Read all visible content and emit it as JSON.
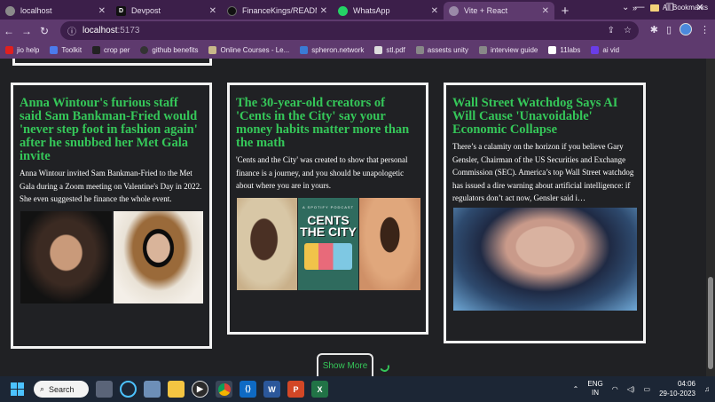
{
  "browser": {
    "tabs": [
      {
        "title": "localhost",
        "active": false,
        "favicon": "globe-icon"
      },
      {
        "title": "Devpost",
        "active": false,
        "favicon": "devpost-icon"
      },
      {
        "title": "FinanceKings/README.m",
        "active": false,
        "favicon": "github-icon"
      },
      {
        "title": "WhatsApp",
        "active": false,
        "favicon": "whatsapp-icon"
      },
      {
        "title": "Vite + React",
        "active": true,
        "favicon": "globe-icon"
      }
    ],
    "address": {
      "host": "localhost",
      "port": ":5173"
    },
    "bookmarks": [
      {
        "label": "jio help",
        "color": "#e02020"
      },
      {
        "label": "Toolkit",
        "color": "#4b7bec"
      },
      {
        "label": "crop per",
        "color": "#222222"
      },
      {
        "label": "github benefits",
        "color": "#333333"
      },
      {
        "label": "Online Courses - Le...",
        "color": "#c8b88a"
      },
      {
        "label": "spheron.network",
        "color": "#3a7bd5"
      },
      {
        "label": "stl.pdf",
        "color": "#dddddd"
      },
      {
        "label": "assests unity",
        "color": "#888888"
      },
      {
        "label": "interview guide",
        "color": "#888888"
      },
      {
        "label": "11labs",
        "color": "#ffffff"
      },
      {
        "label": "ai vid",
        "color": "#6a3de8"
      }
    ],
    "bookmarks_overflow": "»",
    "all_bookmarks": "All Bookmarks"
  },
  "articles": [
    {
      "title": "Anna Wintour's furious staff said Sam Bankman-Fried would 'never step foot in fashion again' after he snubbed her Met Gala invite",
      "summary": "Anna Wintour invited Sam Bankman-Fried to the Met Gala during a Zoom meeting on Valentine's Day in 2022. She even suggested he finance the whole event."
    },
    {
      "title": "The 30-year-old creators of 'Cents in the City' say your money habits matter more than the math",
      "summary": "'Cents and the City' was created to show that personal finance is a journey, and you should be unapologetic about where you are in yours.",
      "image_text": {
        "top": "A SPOTIFY PODCAST",
        "main": "CENTS THE CITY"
      }
    },
    {
      "title": "Wall Street Watchdog Says AI Will Cause 'Unavoidable' Economic Collapse",
      "summary": "There’s a calamity on the horizon if you believe Gary Gensler, Chairman of the US Securities and Exchange Commission (SEC). America’s top Wall Street watchdog has issued a dire warning about artificial intelligence: if regulators don’t act now, Gensler said i…"
    }
  ],
  "show_more": "Show More",
  "taskbar": {
    "search": "Search",
    "lang": "ENG",
    "region": "IN",
    "time": "04:06",
    "date": "29-10-2023"
  },
  "colors": {
    "headline": "#35c759",
    "page_bg": "#202124",
    "chrome": "#5e3a6e"
  }
}
